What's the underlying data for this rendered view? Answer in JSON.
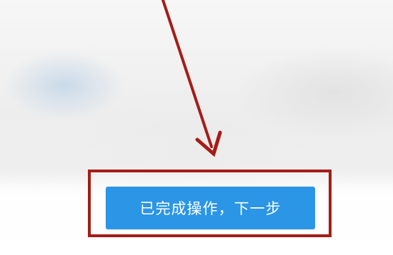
{
  "dialog": {
    "next_button_label": "已完成操作，下一步"
  },
  "annotation": {
    "color": "#a61c17",
    "arrow_icon": "arrow-pointer",
    "box": "highlight-box"
  },
  "colors": {
    "button": "#2b95e6",
    "button_text": "#ffffff",
    "background": "#f3f3f3"
  }
}
